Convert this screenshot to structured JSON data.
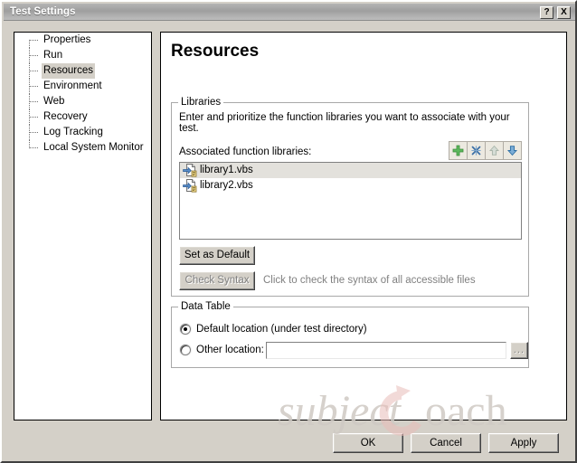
{
  "window": {
    "title": "Test Settings",
    "help_button": "?",
    "close_button": "X"
  },
  "sidebar": {
    "items": [
      {
        "label": "Properties",
        "selected": false
      },
      {
        "label": "Run",
        "selected": false
      },
      {
        "label": "Resources",
        "selected": true
      },
      {
        "label": "Environment",
        "selected": false
      },
      {
        "label": "Web",
        "selected": false
      },
      {
        "label": "Recovery",
        "selected": false
      },
      {
        "label": "Log Tracking",
        "selected": false
      },
      {
        "label": "Local System Monitor",
        "selected": false
      }
    ]
  },
  "main": {
    "title": "Resources",
    "libraries": {
      "group_title": "Libraries",
      "description": "Enter and prioritize the function libraries you want to associate with your test.",
      "list_label": "Associated function libraries:",
      "toolbar": [
        {
          "name": "add-icon",
          "tooltip": "Add",
          "enabled": true,
          "color": "#3c9e3c"
        },
        {
          "name": "delete-icon",
          "tooltip": "Delete",
          "enabled": true,
          "color": "#3a6ea5"
        },
        {
          "name": "move-up-icon",
          "tooltip": "Move Up",
          "enabled": false,
          "color": "#b9c4b9"
        },
        {
          "name": "move-down-icon",
          "tooltip": "Move Down",
          "enabled": true,
          "color": "#3a7fc1"
        }
      ],
      "items": [
        {
          "label": "library1.vbs",
          "selected": true
        },
        {
          "label": "library2.vbs",
          "selected": false
        }
      ],
      "set_default_label": "Set as Default",
      "check_syntax_label": "Check Syntax",
      "check_syntax_hint": "Click to check the syntax of all accessible files"
    },
    "data_table": {
      "group_title": "Data Table",
      "default_location_label": "Default location (under test directory)",
      "default_location_selected": true,
      "other_location_label": "Other location:",
      "other_location_selected": false,
      "other_location_value": "",
      "other_location_placeholder": "",
      "browse_label": "..."
    }
  },
  "footer": {
    "ok_label": "OK",
    "cancel_label": "Cancel",
    "apply_label": "Apply"
  },
  "watermark": {
    "text_part1": "subject",
    "text_part2": "oach",
    "logo_letter": "C",
    "color_text": "#cfcac4",
    "color_logo": "#e8c4c0"
  }
}
